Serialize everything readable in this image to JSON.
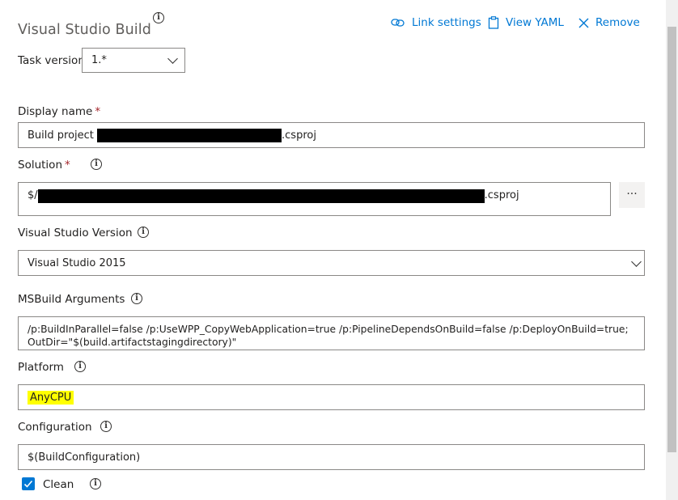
{
  "header": {
    "title": "Visual Studio Build",
    "link_settings": "Link settings",
    "view_yaml": "View YAML",
    "remove": "Remove"
  },
  "task_version": {
    "label": "Task version",
    "value": "1.*"
  },
  "display_name": {
    "label": "Display name",
    "required": "*",
    "value_prefix": "Build project ",
    "value_suffix": ".csproj"
  },
  "solution": {
    "label": "Solution",
    "required": "*",
    "value_prefix": "$/",
    "value_suffix": ".csproj",
    "browse": "···"
  },
  "vs_version": {
    "label": "Visual Studio Version",
    "value": "Visual Studio 2015"
  },
  "msbuild": {
    "label": "MSBuild Arguments",
    "line1": "/p:BuildInParallel=false /p:UseWPP_CopyWebApplication=true /p:PipelineDependsOnBuild=false /p:DeployOnBuild=true;",
    "line2": "OutDir=\"$(build.artifactstagingdirectory)\""
  },
  "platform": {
    "label": "Platform",
    "value": "AnyCPU",
    "highlight_color": "#ffff00"
  },
  "configuration": {
    "label": "Configuration",
    "value": "$(BuildConfiguration)"
  },
  "clean": {
    "label": "Clean",
    "checked": true
  },
  "icons": {
    "info": "i"
  },
  "colors": {
    "accent": "#0078d4",
    "required": "#a4262c"
  }
}
